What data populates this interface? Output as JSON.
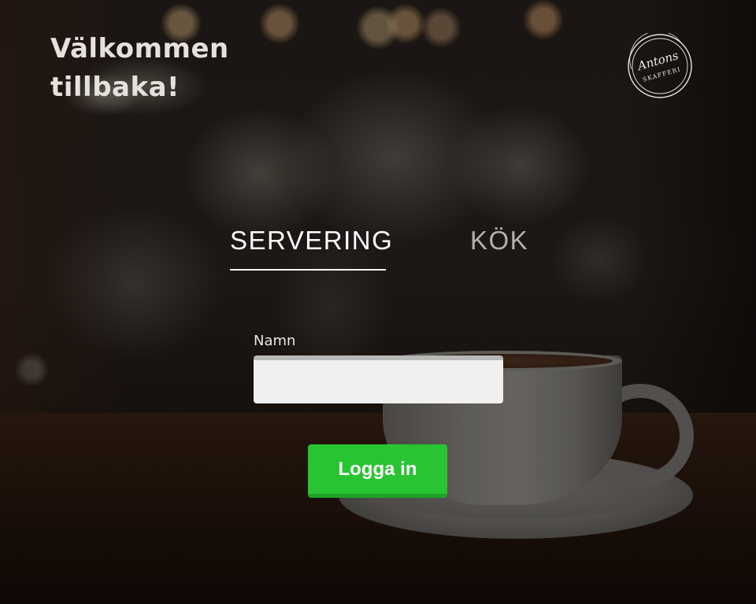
{
  "header": {
    "welcome_line1": "Välkommen",
    "welcome_line2": "tillbaka!"
  },
  "logo": {
    "script_text": "Antons",
    "sub_text": "SKAFFERI"
  },
  "tabs": [
    {
      "label": "SERVERING",
      "active": true
    },
    {
      "label": "KÖK",
      "active": false
    }
  ],
  "form": {
    "name_label": "Namn",
    "name_value": "",
    "login_label": "Logga in"
  },
  "colors": {
    "accent_green": "#29c431",
    "active_tab_underline": "#ffffff",
    "inactive_tab_text": "#b4b0ac"
  }
}
